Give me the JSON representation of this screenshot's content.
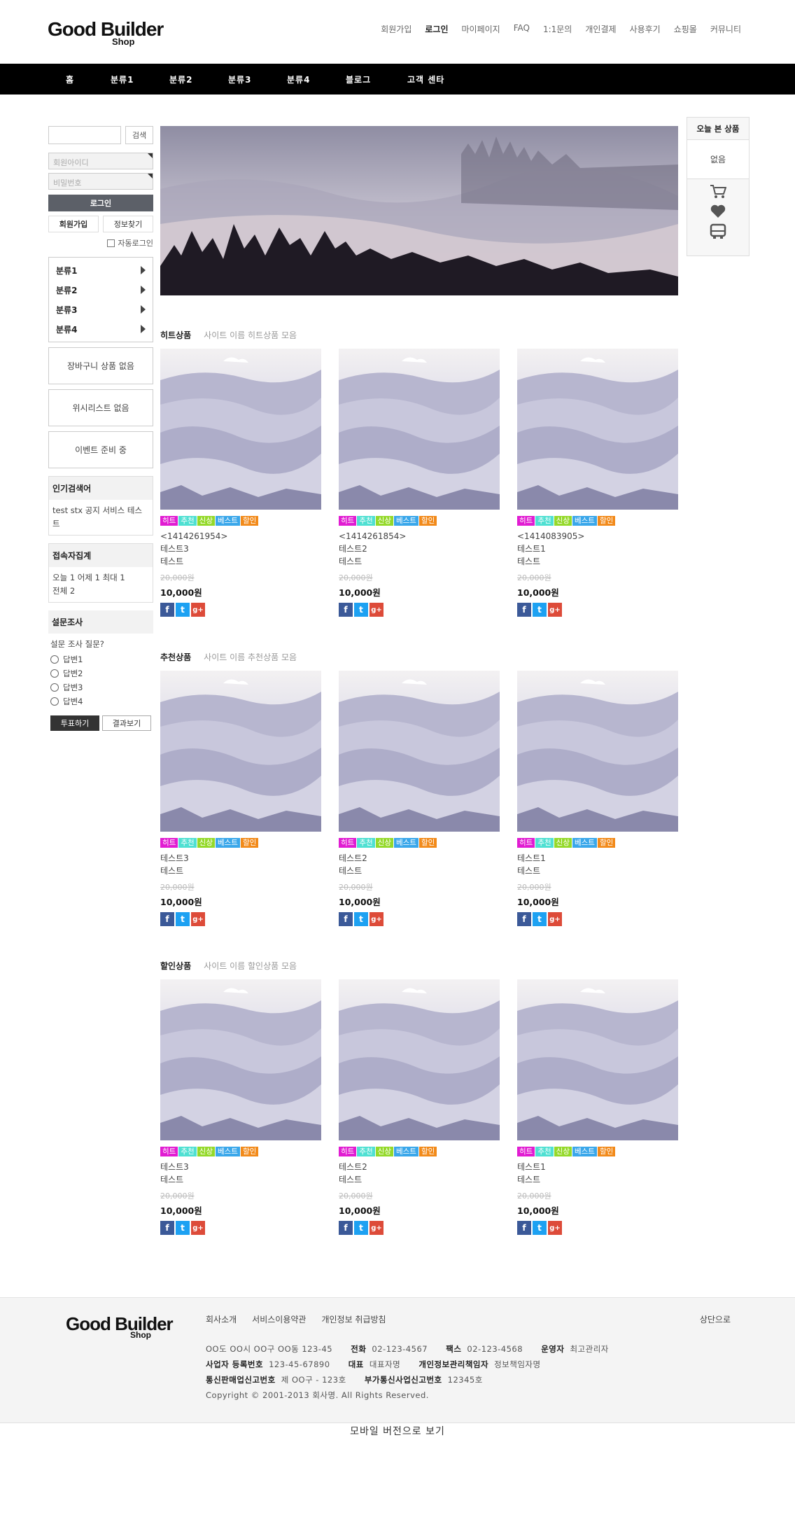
{
  "logo": {
    "main": "Good Builder",
    "sub": "Shop"
  },
  "top_nav": [
    {
      "label": "회원가입",
      "bold": false
    },
    {
      "label": "로그인",
      "bold": true
    },
    {
      "label": "마이페이지",
      "bold": false
    },
    {
      "label": "FAQ",
      "bold": false
    },
    {
      "label": "1:1문의",
      "bold": false
    },
    {
      "label": "개인결제",
      "bold": false
    },
    {
      "label": "사용후기",
      "bold": false
    },
    {
      "label": "쇼핑몰",
      "bold": false
    },
    {
      "label": "커뮤니티",
      "bold": false
    }
  ],
  "main_nav": [
    "홈",
    "분류1",
    "분류2",
    "분류3",
    "분류4",
    "블로그",
    "고객 센타"
  ],
  "search": {
    "button": "검색"
  },
  "login": {
    "id_placeholder": "회원아이디",
    "pw_placeholder": "비밀번호",
    "login_button": "로그인",
    "join_button": "회원가입",
    "find_button": "정보찾기",
    "auto_login": "자동로그인"
  },
  "categories": [
    "분류1",
    "분류2",
    "분류3",
    "분류4"
  ],
  "side_boxes": {
    "cart": "장바구니 상품 없음",
    "wishlist": "위시리스트 없음",
    "event": "이벤트 준비 중"
  },
  "popular": {
    "title": "인기검색어",
    "items": "test stx 공지 서비스 테스트"
  },
  "visitors": {
    "title": "접속자집계",
    "line1": "오늘 1 어제 1 최대 1",
    "line2": "전체 2"
  },
  "poll": {
    "title": "설문조사",
    "question": "설문 조사 질문?",
    "options": [
      "답변1",
      "답변2",
      "답변3",
      "답변4"
    ],
    "vote": "투표하기",
    "result": "결과보기"
  },
  "recent": {
    "title": "오늘 본 상품",
    "empty": "없음"
  },
  "badges": [
    {
      "label": "히트",
      "color": "#e11cd2"
    },
    {
      "label": "추천",
      "color": "#4fe0d2"
    },
    {
      "label": "신상",
      "color": "#94d92a"
    },
    {
      "label": "베스트",
      "color": "#3aa7ea"
    },
    {
      "label": "할인",
      "color": "#f28a1a"
    }
  ],
  "sections": [
    {
      "title": "히트상품",
      "subtitle": "사이트 이름 히트상품 모음",
      "products": [
        {
          "code": "<1414261954>",
          "name": "테스트3",
          "desc": "테스트",
          "old_price": "20,000원",
          "price": "10,000원"
        },
        {
          "code": "<1414261854>",
          "name": "테스트2",
          "desc": "테스트",
          "old_price": "20,000원",
          "price": "10,000원"
        },
        {
          "code": "<1414083905>",
          "name": "테스트1",
          "desc": "테스트",
          "old_price": "20,000원",
          "price": "10,000원"
        }
      ]
    },
    {
      "title": "추천상품",
      "subtitle": "사이트 이름 추천상품 모음",
      "products": [
        {
          "name": "테스트3",
          "desc": "테스트",
          "old_price": "20,000원",
          "price": "10,000원"
        },
        {
          "name": "테스트2",
          "desc": "테스트",
          "old_price": "20,000원",
          "price": "10,000원"
        },
        {
          "name": "테스트1",
          "desc": "테스트",
          "old_price": "20,000원",
          "price": "10,000원"
        }
      ]
    },
    {
      "title": "할인상품",
      "subtitle": "사이트 이름 할인상품 모음",
      "products": [
        {
          "name": "테스트3",
          "desc": "테스트",
          "old_price": "20,000원",
          "price": "10,000원"
        },
        {
          "name": "테스트2",
          "desc": "테스트",
          "old_price": "20,000원",
          "price": "10,000원"
        },
        {
          "name": "테스트1",
          "desc": "테스트",
          "old_price": "20,000원",
          "price": "10,000원"
        }
      ]
    }
  ],
  "share": {
    "facebook": "f",
    "twitter": "t",
    "google": "g+"
  },
  "footer": {
    "logo_main": "Good Builder",
    "logo_sub": "Shop",
    "links": [
      "회사소개",
      "서비스이용약관",
      "개인정보 취급방침"
    ],
    "top": "상단으로",
    "address": "OO도 OO시 OO구 OO동 123-45",
    "tel_label": "전화",
    "tel": "02-123-4567",
    "fax_label": "팩스",
    "fax": "02-123-4568",
    "operator_label": "운영자",
    "operator": "최고관리자",
    "biz_label": "사업자 등록번호",
    "biz": "123-45-67890",
    "ceo_label": "대표",
    "ceo": "대표자명",
    "privacy_label": "개인정보관리책임자",
    "privacy": "정보책임자명",
    "mail_label": "통신판매업신고번호",
    "mail": "제 OO구 - 123호",
    "vas_label": "부가통신사업신고번호",
    "vas": "12345호",
    "copyright": "Copyright © 2001-2013 회사명. All Rights Reserved."
  },
  "mobile_link": "모바일 버전으로 보기"
}
